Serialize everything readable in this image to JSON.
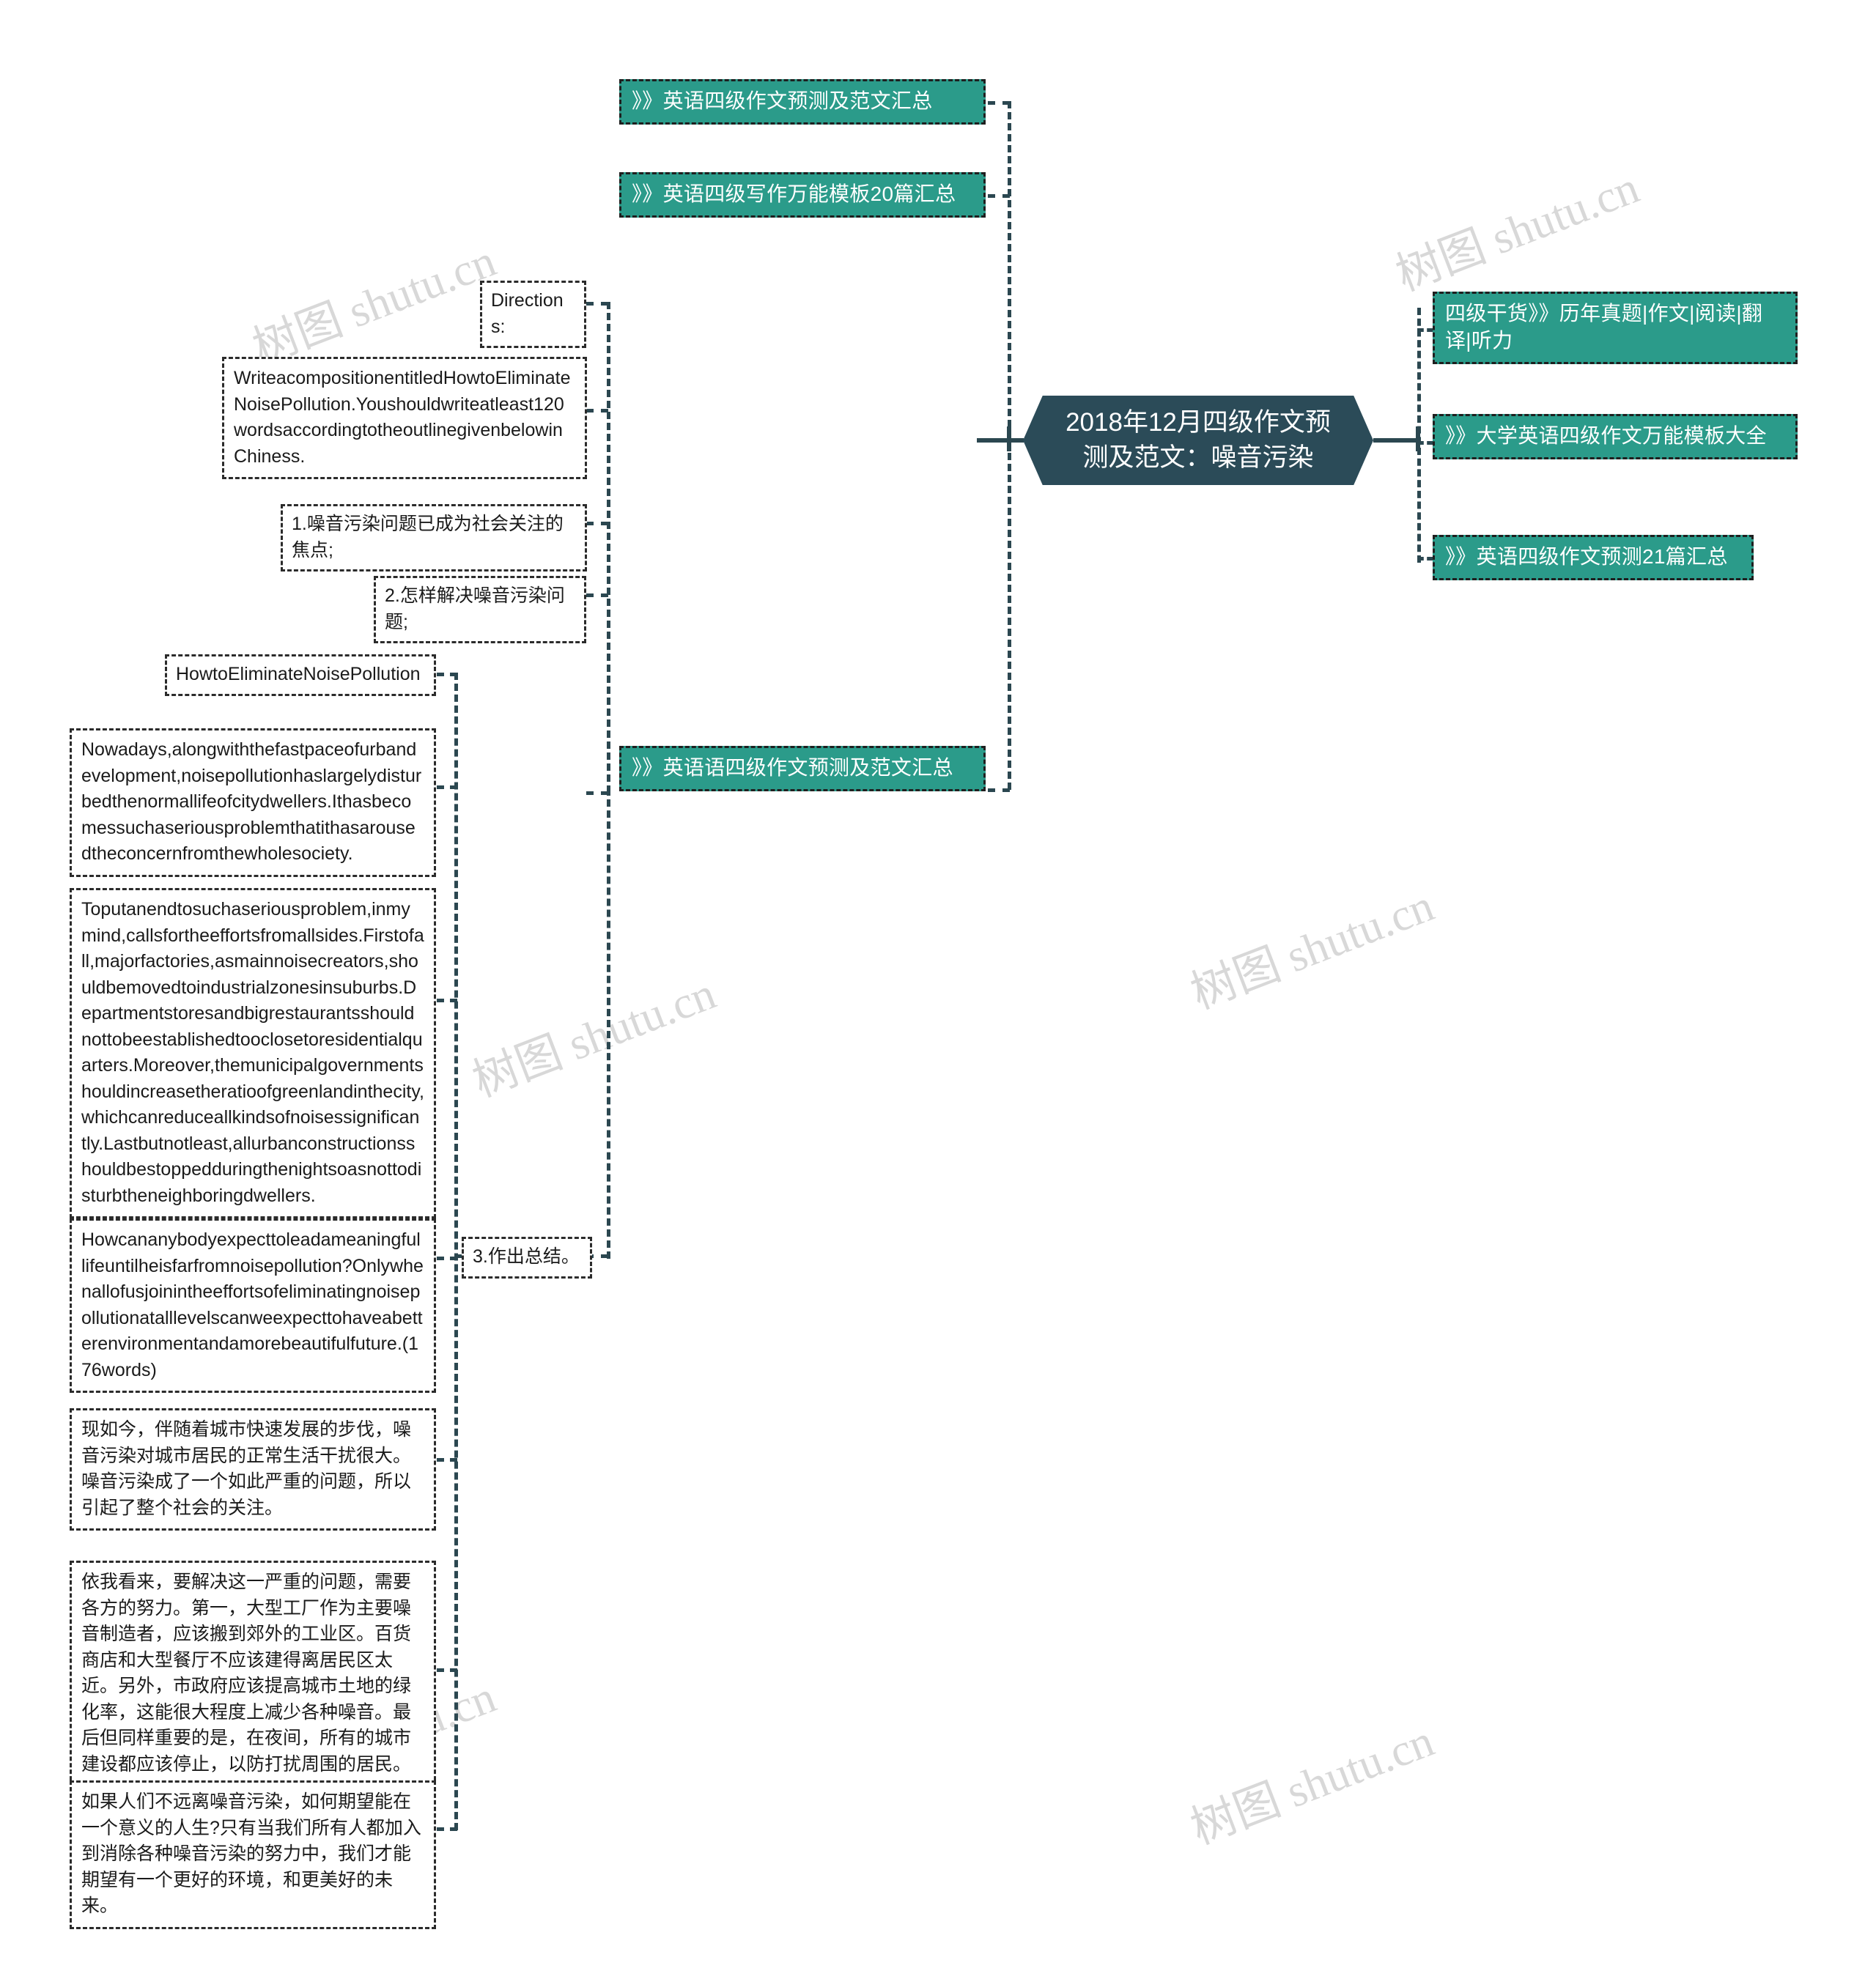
{
  "document": {
    "type": "mindmap",
    "title": "2018年12月四级作文预测及范文：噪音污染",
    "watermark_text": "树图 shutu.cn"
  },
  "center": {
    "label": "2018年12月四级作文预测及范文：噪音污染",
    "bg_color": "#2b4b58",
    "text_color": "#ffffff"
  },
  "colors": {
    "teal": "#2b9b8a",
    "dark": "#2b4b58",
    "connector": "#2b4750",
    "watermark": "#d8d8d8"
  },
  "left_links": {
    "items": [
      {
        "label": "》》英语四级作文预测及范文汇总"
      },
      {
        "label": "》》英语四级写作万能模板20篇汇总"
      },
      {
        "label": "》》英语语四级作文预测及范文汇总"
      }
    ]
  },
  "right_links": {
    "items": [
      {
        "label": "四级干货》》历年真题|作文|阅读|翻译|听力"
      },
      {
        "label": "》》大学英语四级作文万能模板大全"
      },
      {
        "label": "》》英语四级作文预测21篇汇总"
      }
    ]
  },
  "outline": {
    "directions_label": "Directions:",
    "directions_body": "WriteacompositionentitledHowtoEliminateNoisePollution.Youshouldwriteatleast120wordsaccordingtotheoutlinegivenbelowinChiness.",
    "points": [
      {
        "label": "1.噪音污染问题已成为社会关注的焦点;"
      },
      {
        "label": "2.怎样解决噪音污染问题;"
      },
      {
        "label": "3.作出总结。"
      }
    ]
  },
  "essay": {
    "title": "HowtoEliminateNoisePollution",
    "paragraphs": [
      {
        "text": "Nowadays,alongwiththefastpaceofurbandevelopment,noisepollutionhaslargelydisturbedthenormallifeofcitydwellers.Ithasbecomessuchaseriousproblemthatithasarousedtheconcernfromthewholesociety."
      },
      {
        "text": "Toputanendtosuchaseriousproblem,inmymind,callsfortheeffortsfromallsides.Firstofall,majorfactories,asmainnoisecreators,shouldbemovedtoindustrialzonesinsuburbs.Departmentstoresandbigrestaurantsshouldnottobeestablishedtooclosetoresidentialquarters.Moreover,themunicipalgovernmentshouldincreasetheratioofgreenlandinthecity,whichcanreduceallkindsofnoisessignificantly.Lastbutnotleast,allurbanconstructionsshouldbestoppedduringthenightsoasnottodisturbtheneighboringdwellers."
      },
      {
        "text": "Howcananybodyexpecttoleadameaningfullifeuntilheisfarfromnoisepollution?Onlywhenallofusjoinintheeffortsofeliminatingnoisepollutionatalllevelscanweexpecttohaveabetterenvironmentandamorebeautifulfuture.(176words)"
      }
    ]
  },
  "translation": {
    "paragraphs": [
      {
        "text": "现如今，伴随着城市快速发展的步伐，噪音污染对城市居民的正常生活干扰很大。噪音污染成了一个如此严重的问题，所以引起了整个社会的关注。"
      },
      {
        "text": "依我看来，要解决这一严重的问题，需要各方的努力。第一，大型工厂作为主要噪音制造者，应该搬到郊外的工业区。百货商店和大型餐厅不应该建得离居民区太近。另外，市政府应该提高城市土地的绿化率，这能很大程度上减少各种噪音。最后但同样重要的是，在夜间，所有的城市建设都应该停止，以防打扰周围的居民。"
      },
      {
        "text": "如果人们不远离噪音污染，如何期望能在一个意义的人生?只有当我们所有人都加入到消除各种噪音污染的努力中，我们才能期望有一个更好的环境，和更美好的未来。"
      }
    ]
  }
}
